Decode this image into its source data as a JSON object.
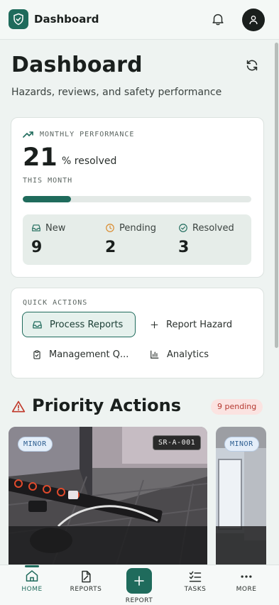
{
  "app": {
    "title": "Dashboard"
  },
  "page": {
    "title": "Dashboard",
    "subtitle": "Hazards, reviews, and safety performance"
  },
  "performance": {
    "eyebrow": "MONTHLY PERFORMANCE",
    "value": "21",
    "unit": "% resolved",
    "period": "THIS MONTH",
    "progress_fraction": 0.21,
    "stats": [
      {
        "icon": "inbox-icon",
        "label": "New",
        "value": "9"
      },
      {
        "icon": "clock-icon",
        "label": "Pending",
        "value": "2"
      },
      {
        "icon": "check-circle-icon",
        "label": "Resolved",
        "value": "3"
      }
    ]
  },
  "quick_actions": {
    "eyebrow": "QUICK ACTIONS",
    "items": [
      {
        "icon": "inbox-icon",
        "label": "Process Reports"
      },
      {
        "icon": "plus-icon",
        "label": "Report Hazard"
      },
      {
        "icon": "clipboard-icon",
        "label": "Management Q..."
      },
      {
        "icon": "bar-chart-icon",
        "label": "Analytics"
      }
    ]
  },
  "priority": {
    "title": "Priority Actions",
    "badge": "9 pending",
    "cards": [
      {
        "severity": "MINOR",
        "id": "SR-A-001"
      },
      {
        "severity": "MINOR"
      }
    ]
  },
  "nav": {
    "items": [
      {
        "label": "HOME",
        "icon": "home-icon",
        "active": true
      },
      {
        "label": "REPORTS",
        "icon": "document-icon"
      },
      {
        "label": "REPORT",
        "icon": "plus-icon"
      },
      {
        "label": "TASKS",
        "icon": "checklist-icon"
      },
      {
        "label": "MORE",
        "icon": "more-icon"
      }
    ]
  },
  "colors": {
    "accent": "#1f6b5c",
    "danger": "#c0392b",
    "background": "#eef3f1"
  }
}
